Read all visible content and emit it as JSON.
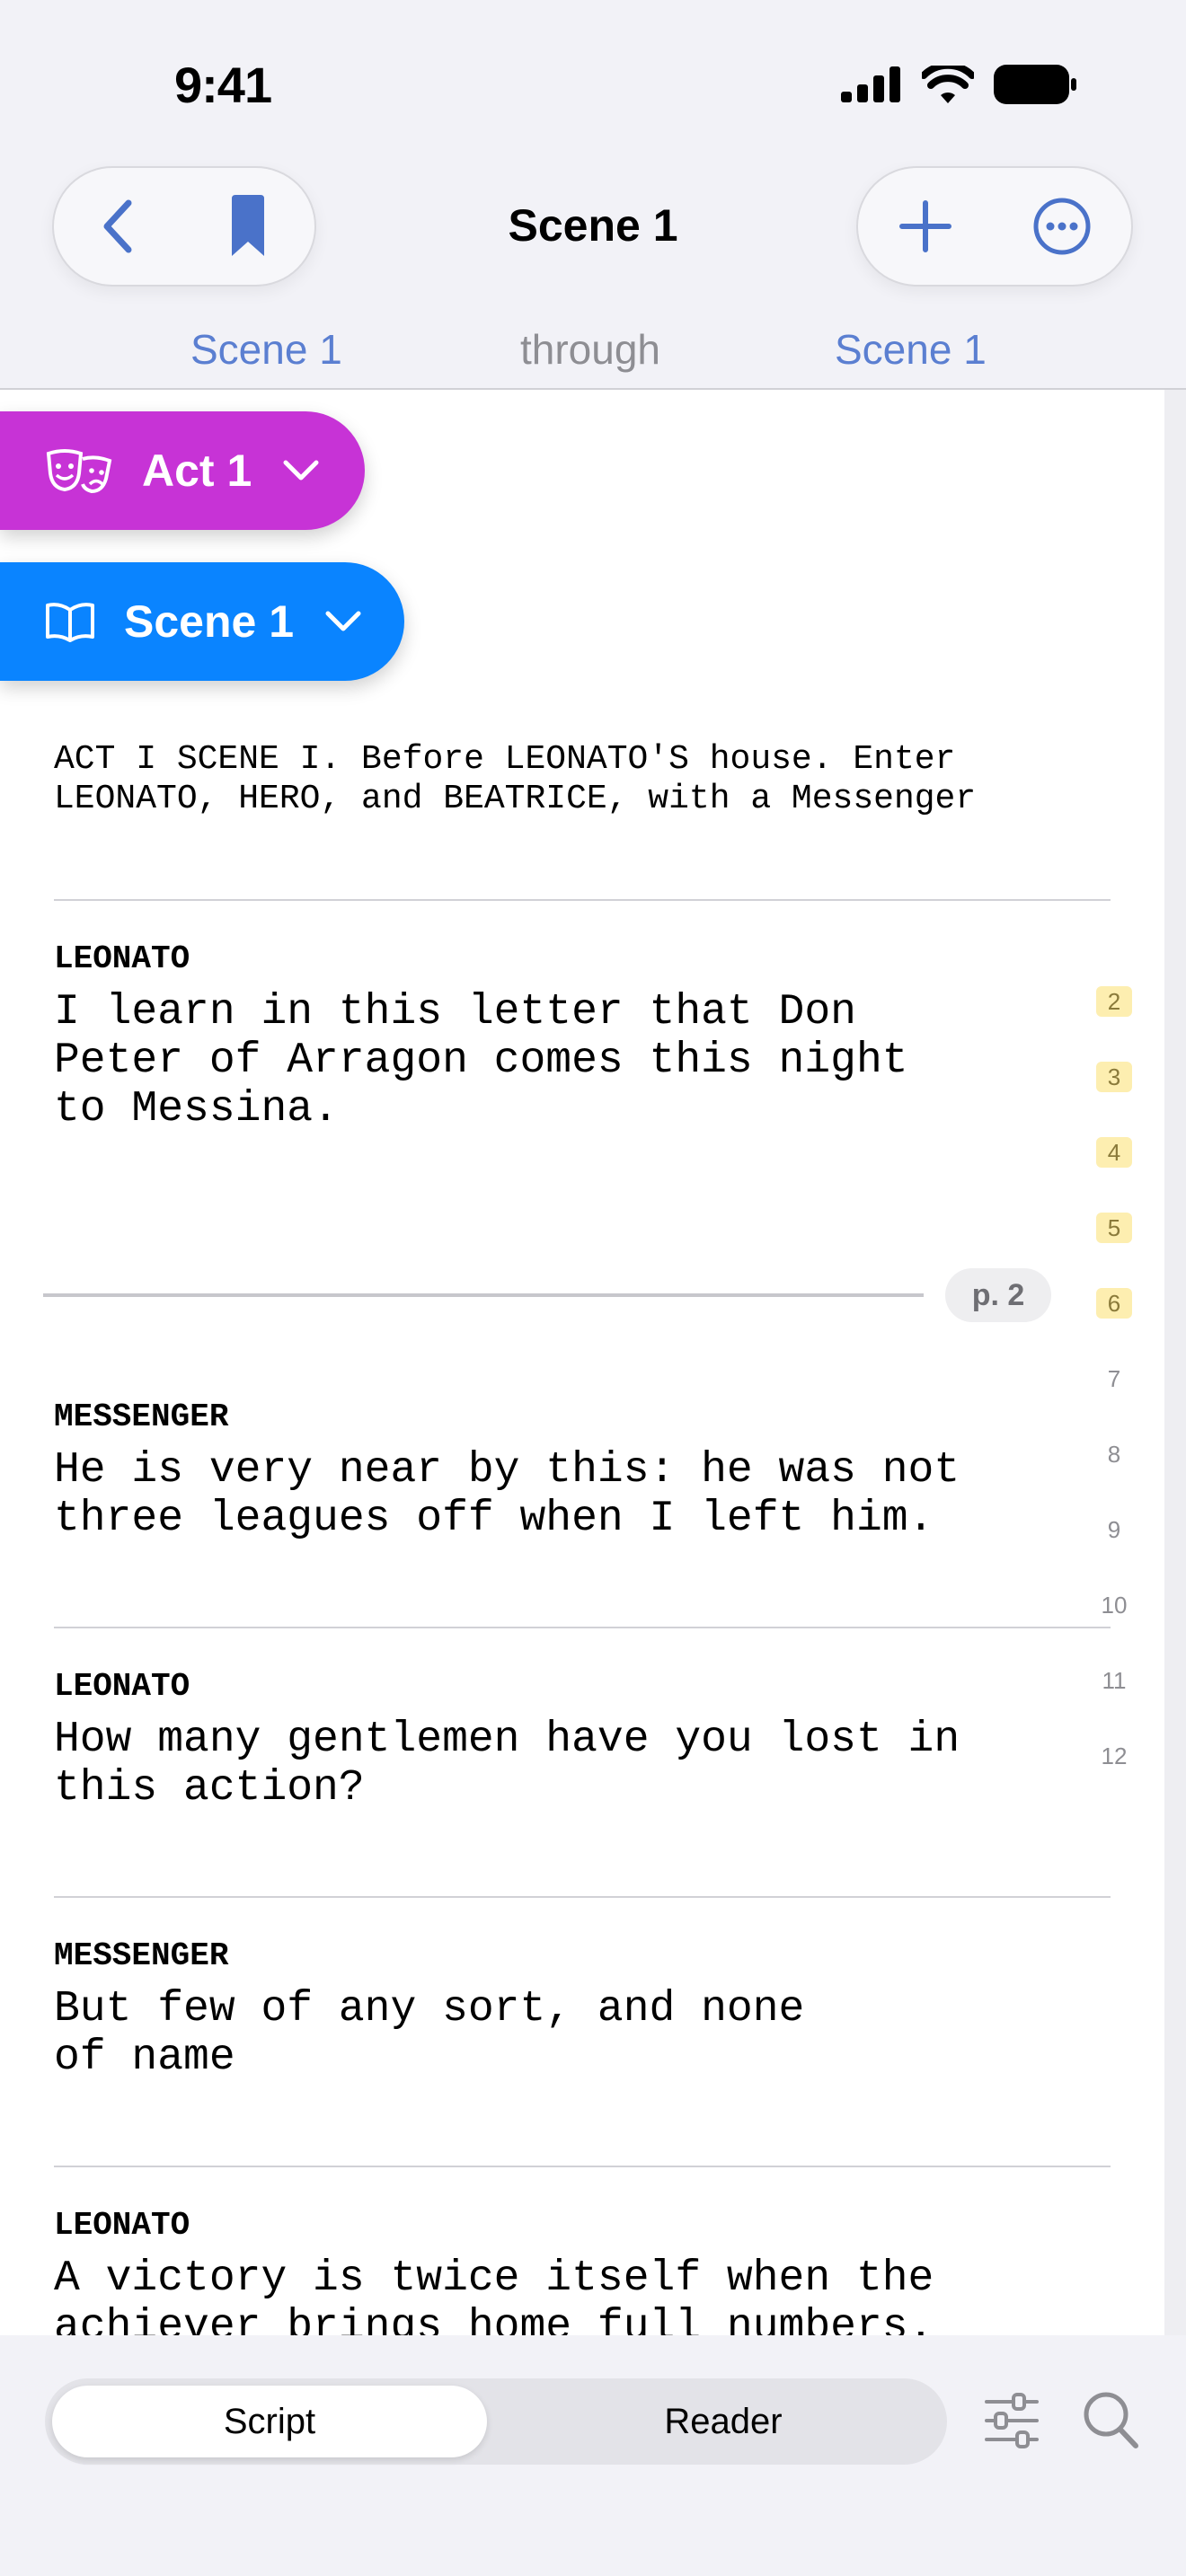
{
  "status_bar": {
    "time": "9:41"
  },
  "nav": {
    "title": "Scene 1",
    "range_start": "Scene 1",
    "range_word": "through",
    "range_end": "Scene 1"
  },
  "chips": {
    "act": "Act 1",
    "scene": "Scene 1"
  },
  "script": {
    "scene_heading": "ACT I SCENE I. Before LEONATO'S house. Enter\nLEONATO, HERO, and BEATRICE, with a Messenger",
    "blocks": [
      {
        "speaker": "LEONATO",
        "text": "I learn in this letter that Don\nPeter of Arragon comes this night\nto Messina."
      },
      {
        "speaker": "MESSENGER",
        "text": "He is very near by this: he was not\nthree leagues off when I left him."
      },
      {
        "speaker": "LEONATO",
        "text": "How many gentlemen have you lost in\nthis action?"
      },
      {
        "speaker": "MESSENGER",
        "text": "But few of any sort, and none\nof name"
      },
      {
        "speaker": "LEONATO",
        "text": "A victory is twice itself when the\nachiever brings home full numbers."
      }
    ],
    "page_break_label": "p. 2",
    "line_numbers": [
      "2",
      "3",
      "4",
      "5",
      "6",
      "7",
      "8",
      "9",
      "10",
      "11",
      "12"
    ],
    "highlighted_line_numbers": [
      "2",
      "3",
      "4",
      "5",
      "6"
    ]
  },
  "bottom_bar": {
    "script_tab": "Script",
    "reader_tab": "Reader",
    "selected_tab": "Script"
  },
  "colors": {
    "accent_blue": "#0a84ff",
    "act_purple": "#c733d6",
    "link_blue": "#5b7fd1"
  },
  "icons": [
    "back-chevron-icon",
    "bookmark-icon",
    "plus-icon",
    "more-ellipsis-icon",
    "theater-masks-icon",
    "book-icon",
    "chevron-down-icon",
    "sliders-icon",
    "search-icon"
  ]
}
